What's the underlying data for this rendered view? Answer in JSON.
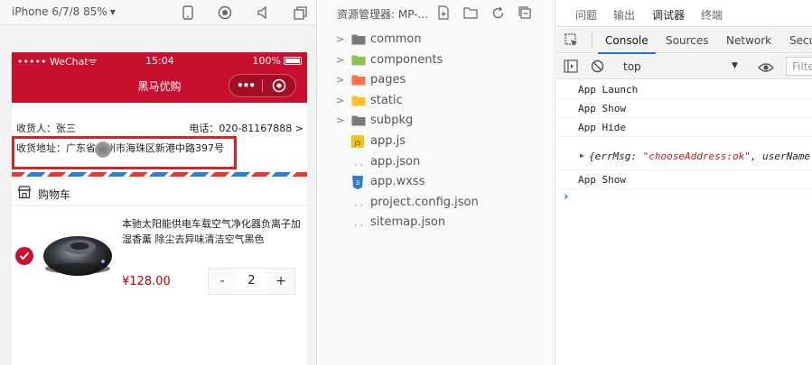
{
  "simulator": {
    "device_label": "iPhone 6/7/8 85%",
    "icons": [
      "phone-icon",
      "record-icon",
      "volume-icon",
      "window-icon"
    ]
  },
  "phone": {
    "status": {
      "signal": "••••• WeChat",
      "wifi": "wifi-icon",
      "time": "15:04",
      "battery": "100%"
    },
    "nav_title": "黑马优购",
    "capsule": {
      "more": "•••",
      "close": "target-icon"
    },
    "address": {
      "receiver": "收货人：张三",
      "phone": "电话：020-81167888",
      "detail": "收货地址：广东省广州市海珠区新港中路397号"
    },
    "cart": {
      "title": "购物车",
      "goods": {
        "name": "本驰太阳能供电车载空气净化器负离子加湿香薰 除尘去异味清洁空气黑色",
        "price": "¥128.00",
        "count": "2",
        "minus": "-",
        "plus": "+"
      }
    },
    "colors": {
      "brand": "#c8102e",
      "highlight": "#e02020",
      "price": "#c00000"
    }
  },
  "explorer": {
    "title": "资源管理器: MP-...",
    "items": [
      {
        "name": "common",
        "kind": "folder",
        "color": "#7a7a7a"
      },
      {
        "name": "components",
        "kind": "folder",
        "color": "#8bc34a"
      },
      {
        "name": "pages",
        "kind": "folder",
        "color": "#ff7043"
      },
      {
        "name": "static",
        "kind": "folder",
        "color": "#fbc02d"
      },
      {
        "name": "subpkg",
        "kind": "folder",
        "color": "#7a7a7a"
      },
      {
        "name": "app.js",
        "kind": "js"
      },
      {
        "name": "app.json",
        "kind": "json"
      },
      {
        "name": "app.wxss",
        "kind": "css"
      },
      {
        "name": "project.config.json",
        "kind": "json"
      },
      {
        "name": "sitemap.json",
        "kind": "json"
      }
    ]
  },
  "devtools": {
    "tabs": [
      "问题",
      "输出",
      "调试器",
      "终端"
    ],
    "active_tab": "调试器",
    "subtabs": [
      "Console",
      "Sources",
      "Network",
      "Secu"
    ],
    "context": "top",
    "filter_placeholder": "Filte",
    "logs": [
      "App Launch",
      "App Show",
      "App Hide"
    ],
    "object_log": {
      "prefix": "{errMsg: ",
      "value": "\"chooseAddress:ok\"",
      "suffix": ", userName"
    },
    "last_log": "App Show",
    "prompt": "›"
  }
}
